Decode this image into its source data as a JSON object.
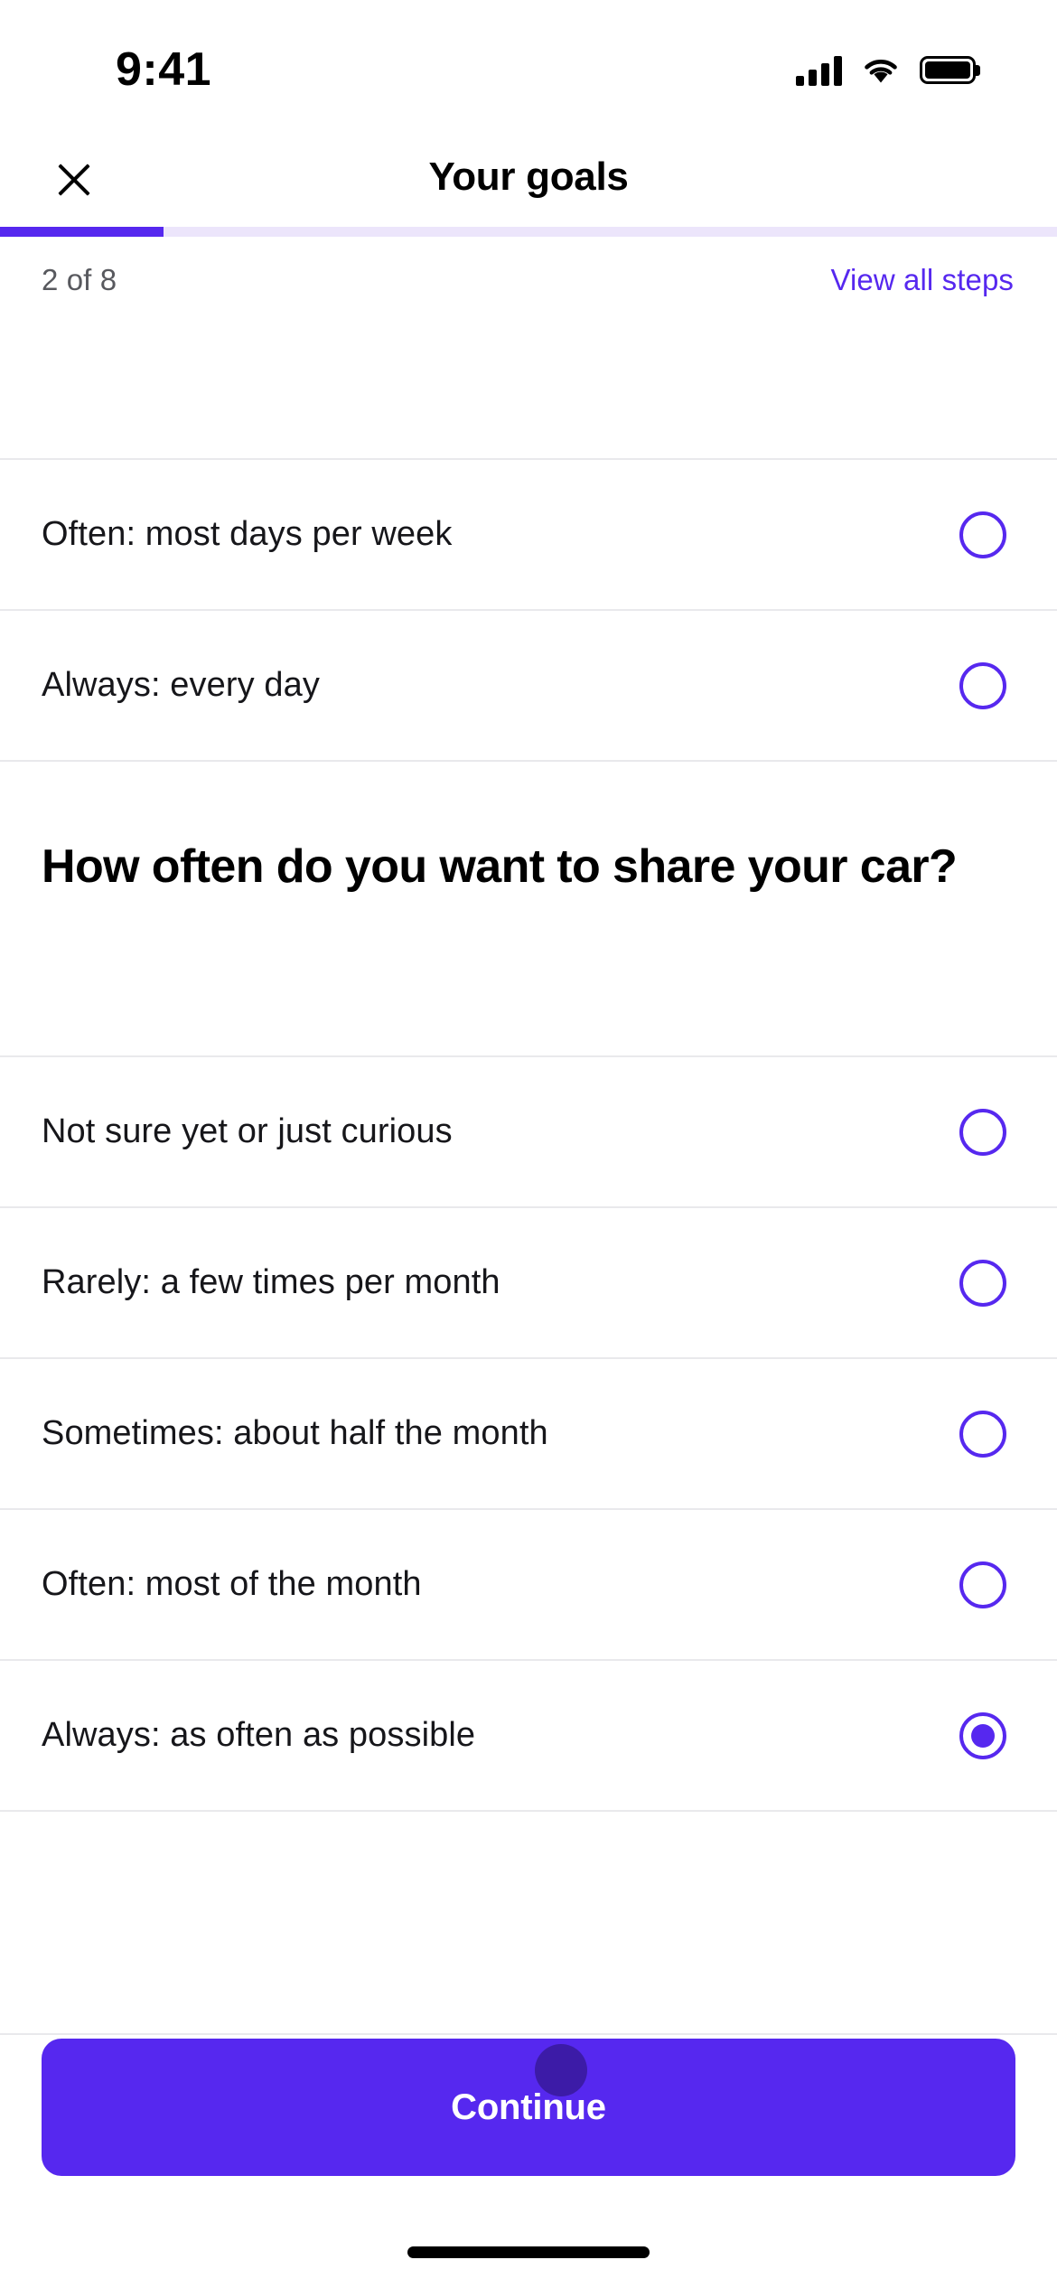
{
  "status_bar": {
    "time": "9:41",
    "cellular_icon": "signal-bars-icon",
    "wifi_icon": "wifi-icon",
    "battery_icon": "battery-full-icon"
  },
  "header": {
    "close_icon": "close-icon",
    "title": "Your goals"
  },
  "progress": {
    "percent": 15.5,
    "step_label": "2 of 8",
    "view_all_label": "View all steps",
    "fill_color": "#5628ef",
    "track_color": "#ece5fb"
  },
  "previous_question_options": [
    {
      "label": "Often: most days per week",
      "selected": false
    },
    {
      "label": "Always: every day",
      "selected": false
    }
  ],
  "question": {
    "title": "How often do you want to share your car?"
  },
  "options": [
    {
      "label": "Not sure yet or just curious",
      "selected": false
    },
    {
      "label": "Rarely: a few times per month",
      "selected": false
    },
    {
      "label": "Sometimes: about half the month",
      "selected": false
    },
    {
      "label": "Often: most of the month",
      "selected": false
    },
    {
      "label": "Always: as often as possible",
      "selected": true
    }
  ],
  "footer": {
    "continue_label": "Continue",
    "button_color": "#5628ef"
  },
  "colors": {
    "accent": "#5628ef",
    "text_primary": "#16161a",
    "text_secondary": "#58595e",
    "divider": "#e9e9ec"
  }
}
